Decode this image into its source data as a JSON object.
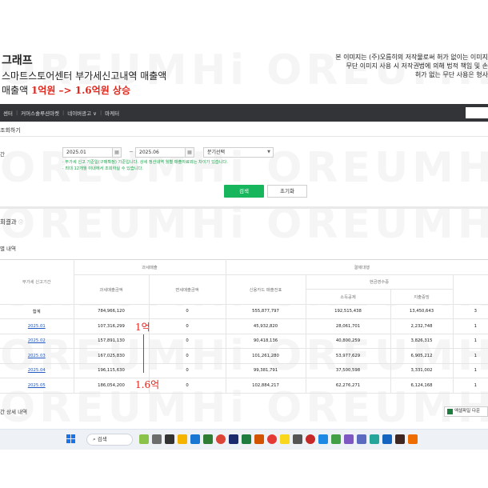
{
  "heading": {
    "line1": "그래프",
    "line2": "스마트스토어센터 부가세신고내역 매출액",
    "line3_pre": "매출액 ",
    "line3_hl": "1억원 –> 1.6억원 상승"
  },
  "notice": {
    "line1": "본 이미지는 (주)오름히의 저작물로써 허가 없이는 이미지",
    "line2": "무단 이미지 사용 시 저작권법에 의해 법적 책임 및 손",
    "line3": "허가 없는 무단 사용은 형사"
  },
  "nav": {
    "items": [
      "센터",
      "커머스솔루션마켓",
      "네이버광고 ∨",
      "마케터"
    ]
  },
  "filter": {
    "title": "조회하기",
    "period_label": "간",
    "start_date": "2025.01",
    "end_date": "2025.06",
    "range_select": "분기선택",
    "help1": "· 부가세 신고 기준일(구매확정) 기준입니다. 상세 정산내역 월별 매출자료와는 차이가 있습니다.",
    "help2": "· 최대 12개월 이내에서 조회하실 수 있습니다.",
    "search_label": "검색",
    "reset_label": "초기화"
  },
  "results": {
    "title": "회결과",
    "subtitle": "별 내역",
    "detail_title": "간 상세 내역",
    "excel_label": "엑셀파일 다운"
  },
  "table": {
    "group1": "과세매출",
    "group2": "결제대행",
    "subgroup": "현금영수증",
    "headers": {
      "period": "부가세 신고기간",
      "taxable": "과세매출금액",
      "exempt": "면세매출금액",
      "card": "신용카드 매출전표",
      "income": "소득공제",
      "expense": "지출증빙"
    },
    "rows": [
      {
        "period": "합계",
        "taxable": "784,966,120",
        "exempt": "0",
        "card": "555,877,797",
        "income": "192,515,438",
        "expense": "13,450,643",
        "extra": "3"
      },
      {
        "period": "2025.01",
        "taxable": "107,316,299",
        "exempt": "0",
        "card": "45,932,820",
        "income": "28,061,701",
        "expense": "2,232,748",
        "extra": "1"
      },
      {
        "period": "2025.02",
        "taxable": "157,891,130",
        "exempt": "0",
        "card": "90,418,136",
        "income": "40,800,259",
        "expense": "3,826,315",
        "extra": "1"
      },
      {
        "period": "2025.03",
        "taxable": "167,025,830",
        "exempt": "0",
        "card": "101,261,280",
        "income": "53,977,629",
        "expense": "6,905,212",
        "extra": "1"
      },
      {
        "period": "2025.04",
        "taxable": "196,115,630",
        "exempt": "0",
        "card": "99,381,791",
        "income": "37,500,598",
        "expense": "3,331,002",
        "extra": "1"
      },
      {
        "period": "2025.05",
        "taxable": "186,054,200",
        "exempt": "0",
        "card": "102,884,217",
        "income": "62,276,271",
        "expense": "6,124,168",
        "extra": "1"
      }
    ]
  },
  "annotations": {
    "top": "1억",
    "bottom": "1.6억"
  },
  "watermark": "OREUMHi OREUMHi",
  "taskbar": {
    "search_placeholder": "검색"
  },
  "colors": {
    "accent_red": "#e1261c",
    "search_green": "#17b55c",
    "nav_dark": "#333438",
    "link_blue": "#2158c4"
  }
}
